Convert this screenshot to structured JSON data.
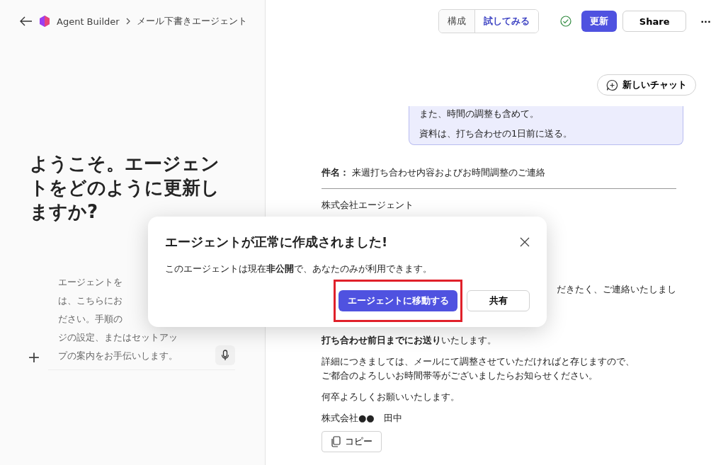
{
  "header": {
    "breadcrumb": [
      "Agent Builder",
      "メール下書きエージェント"
    ],
    "tabs": [
      {
        "label": "構成",
        "selected": false
      },
      {
        "label": "試してみる",
        "selected": true
      }
    ],
    "update_button": "更新",
    "share_button": "Share",
    "more_button": "···"
  },
  "left_panel": {
    "heading": "ようこそ。エージェントをどのように更新しますか?",
    "input_lines": [
      "エージェントを",
      "は、こちらにお",
      "ださい。手順の",
      "ジの設定、またはセットアッ",
      "プの案内をお手伝いします。"
    ],
    "add_button": "+"
  },
  "chat": {
    "new_chat_button": "新しいチャット",
    "user_message": [
      "また、時間の調整も含めて。",
      "資料は、打ち合わせの1日前に送る。"
    ],
    "email": {
      "subject_label": "件名：",
      "subject": "来週打ち合わせ内容およびお時間調整のご連絡",
      "recipient": "株式会社エージェント",
      "fragment": "だきたく、ご連絡いたしまし",
      "paragraphs": [
        [
          "**打ち合わせ前日までにお送り**いたします。"
        ],
        [
          "詳細につきましては、メールにて調整させていただければと存じますので、",
          "ご都合のよろしいお時間帯等がございましたらお知らせください。"
        ],
        [
          "何卒よろしくお願いいたします。"
        ],
        [
          "株式会社●●　田中"
        ]
      ]
    },
    "copy_button": "コピー"
  },
  "dialog": {
    "title": "エージェントが正常に作成されました!",
    "message": "このエージェントは現在**非公開**で、あなたのみが利用できます。",
    "primary_button": "エージェントに移動する",
    "primary_highlighted": true,
    "secondary_button": "共有"
  }
}
